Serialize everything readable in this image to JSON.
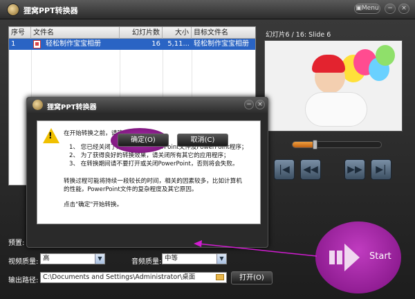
{
  "app": {
    "title": "狸窝PPT转换器",
    "menu_label": "Menu"
  },
  "table": {
    "headers": [
      "序号",
      "文件名",
      "幻灯片数",
      "大小",
      "目标文件名"
    ],
    "rows": [
      {
        "index": "1",
        "name": "轻松制作宝宝相册",
        "slides": "16",
        "size": "5,11...",
        "target": "轻松制作宝宝相册"
      }
    ]
  },
  "preview": {
    "label": "幻灯片6 / 16: Slide 6",
    "progress": 0.25
  },
  "form": {
    "preset_label": "预置:",
    "video_quality_label": "视频质量:",
    "video_quality_value": "高",
    "audio_quality_label": "音频质量:",
    "audio_quality_value": "中等",
    "output_path_label": "输出路径:",
    "output_path_value": "C:\\Documents and Settings\\Administrator\\桌面",
    "open_button": "打开(O)",
    "start_button": "Start"
  },
  "dialog": {
    "title": "狸窝PPT转换器",
    "intro": "在开始转换之前，请确认：",
    "items": [
      "1、 您已经关闭了所有打开的PowerPoint文件及PowerPoint程序；",
      "2、 为了获得良好的转换效果，请关闭所有其它的应用程序；",
      "3、 在转换期间请不要打开或关闭PowerPoint，否则将会失败。"
    ],
    "note1": "转换过程可能将持续一段较长的时间，相关的因素较多，比如计算机",
    "note2": "的性能，PowerPoint文件的复杂程度及其它原因。",
    "click_hint": "点击\"确定\"开始转换。",
    "ok": "确定(O)",
    "cancel": "取消(C)"
  }
}
